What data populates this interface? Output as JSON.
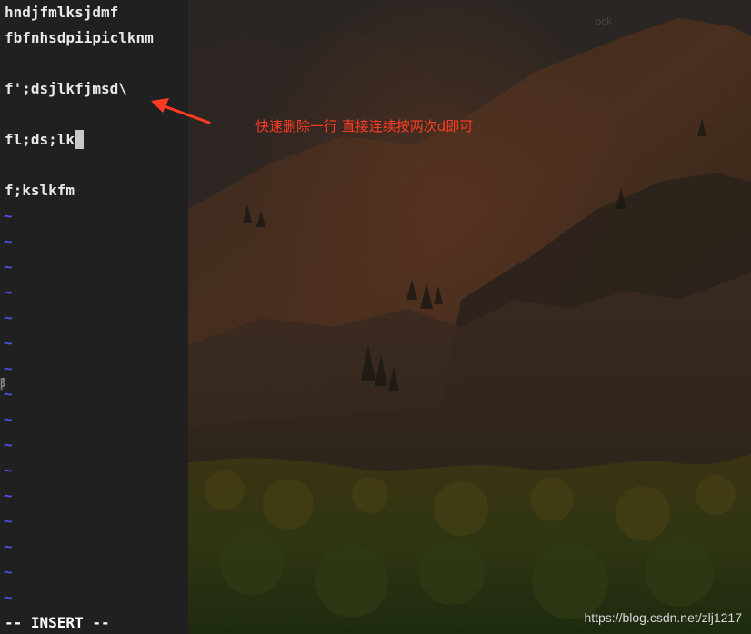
{
  "vim": {
    "lines": [
      "hndjfmlksjdmf",
      "fbfnhsdpiipiclknm",
      "",
      "f';dsjlkfjmsd\\",
      "",
      "fl;ds;lk",
      "",
      "f;kslkfm"
    ],
    "tilde": "~",
    "mode_status": "-- INSERT --"
  },
  "annotation": {
    "text": "快速删除一行 直接连续按两次d即可",
    "color": "#ff3b24"
  },
  "watermark": "https://blog.csdn.net/zlj1217",
  "background_top_text": "ook",
  "stray_char": "除",
  "colors": {
    "terminal_bg": "#202020",
    "text": "#e8e8e8",
    "tilde": "#4a55e6",
    "cursor": "#c8c8c8"
  }
}
